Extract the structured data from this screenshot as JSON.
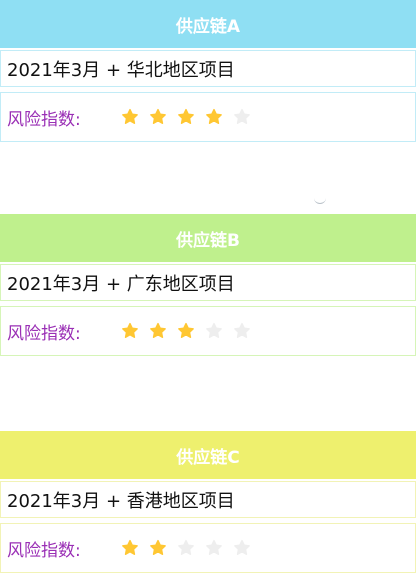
{
  "colors": {
    "card_a_header": "#8fdff3",
    "card_a_border": "#c2ecf7",
    "card_b_header": "#bff08d",
    "card_b_border": "#d6f5b8",
    "card_c_header": "#eef06e",
    "card_c_border": "#f2f3b6",
    "star_filled": "#ffc733",
    "star_empty": "#eeeeee",
    "risk_label": "#9a2fb5"
  },
  "supply_chains": [
    {
      "title": "供应链A",
      "project": "2021年3月 + 华北地区项目",
      "risk_label": "风险指数:",
      "risk_rating": 4,
      "risk_max": 5
    },
    {
      "title": "供应链B",
      "project": "2021年3月 + 广东地区项目",
      "risk_label": "风险指数:",
      "risk_rating": 3,
      "risk_max": 5
    },
    {
      "title": "供应链C",
      "project": "2021年3月 + 香港地区项目",
      "risk_label": "风险指数:",
      "risk_rating": 2,
      "risk_max": 5
    }
  ]
}
